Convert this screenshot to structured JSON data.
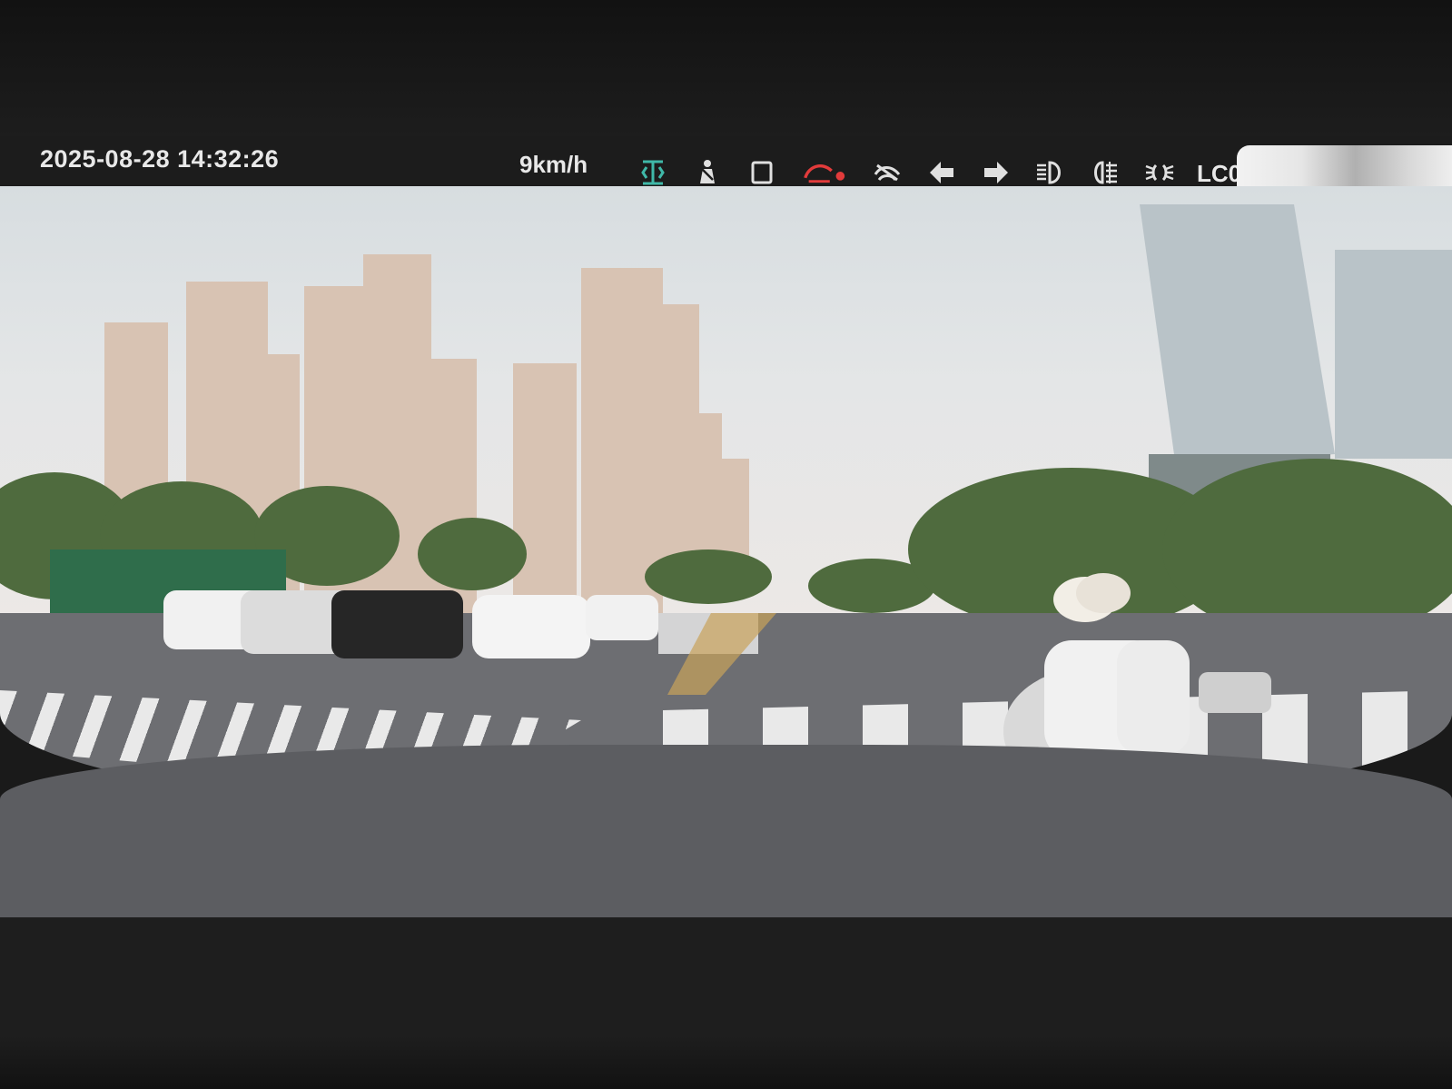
{
  "overlay": {
    "timestamp": "2025-08-28 14:32:26",
    "speed": "9km/h",
    "lc_label": "LC0",
    "indicator_icons": [
      {
        "name": "lane-keep-icon",
        "color": "#3fb8a8"
      },
      {
        "name": "seatbelt-icon",
        "color": "#e0e0e0"
      },
      {
        "name": "door-icon",
        "color": "#e0e0e0"
      },
      {
        "name": "collision-warning-icon",
        "color": "#e23b3b"
      },
      {
        "name": "steering-assist-icon",
        "color": "#e0e0e0"
      },
      {
        "name": "left-turn-signal-icon",
        "color": "#e0e0e0"
      },
      {
        "name": "right-turn-signal-icon",
        "color": "#e0e0e0"
      },
      {
        "name": "headlight-icon",
        "color": "#e0e0e0"
      },
      {
        "name": "fog-light-icon",
        "color": "#e0e0e0"
      },
      {
        "name": "parking-light-icon",
        "color": "#e0e0e0"
      }
    ]
  }
}
